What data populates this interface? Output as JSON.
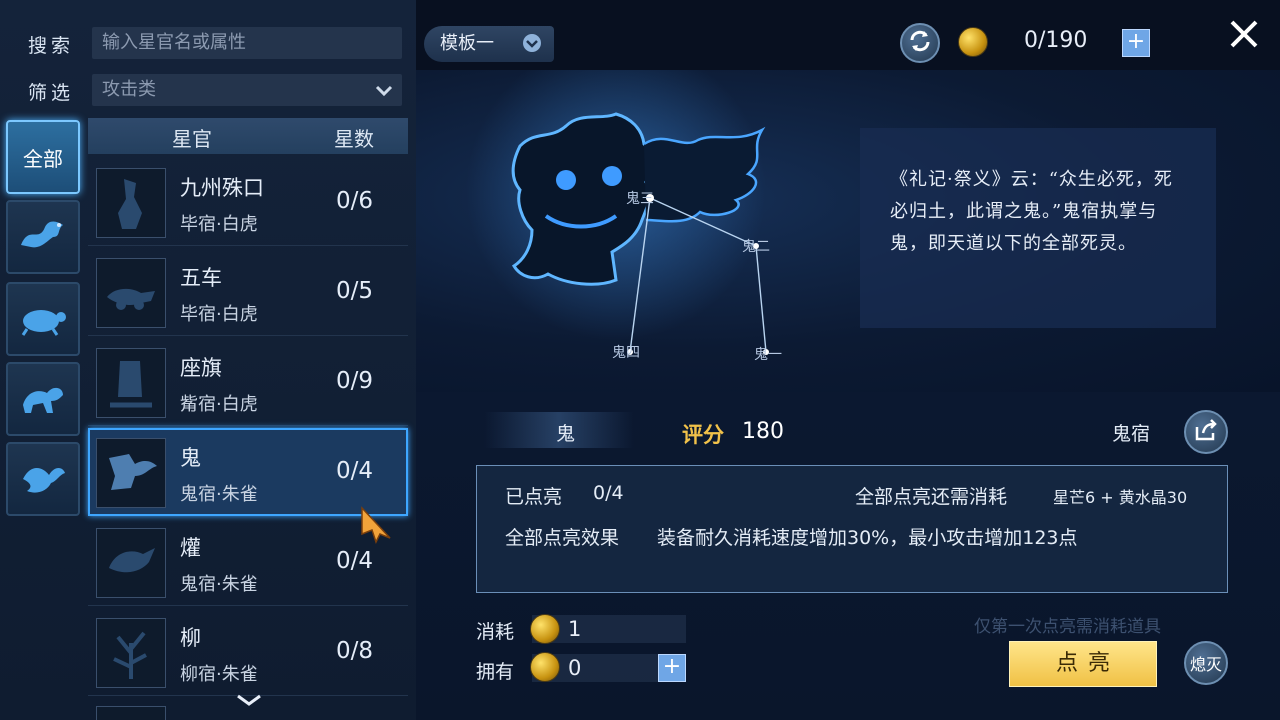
{
  "search": {
    "label": "搜索",
    "placeholder": "输入星官名或属性"
  },
  "filter": {
    "label": "筛选",
    "value": "攻击类"
  },
  "category_tabs": [
    {
      "label": "全部",
      "icon": "all-tab"
    },
    {
      "label": "",
      "icon": "azure-dragon-icon"
    },
    {
      "label": "",
      "icon": "black-tortoise-icon"
    },
    {
      "label": "",
      "icon": "white-tiger-icon"
    },
    {
      "label": "",
      "icon": "vermilion-bird-icon"
    }
  ],
  "list_header": {
    "name": "星官",
    "count": "星数"
  },
  "rows": [
    {
      "name": "九州殊口",
      "sub": "毕宿·白虎",
      "count": "0/6"
    },
    {
      "name": "五车",
      "sub": "毕宿·白虎",
      "count": "0/5"
    },
    {
      "name": "座旗",
      "sub": "觜宿·白虎",
      "count": "0/9"
    },
    {
      "name": "鬼",
      "sub": "鬼宿·朱雀",
      "count": "0/4"
    },
    {
      "name": "爟",
      "sub": "鬼宿·朱雀",
      "count": "0/4"
    },
    {
      "name": "柳",
      "sub": "柳宿·朱雀",
      "count": "0/8"
    }
  ],
  "top_bar": {
    "template": "模板一",
    "currency": "0/190"
  },
  "constellation": {
    "stars": [
      "鬼三",
      "鬼二",
      "鬼四",
      "鬼一"
    ],
    "description": "《礼记·祭义》云：“众生必死，死必归土，此谓之鬼。”鬼宿执掌与鬼，即天道以下的全部死灵。"
  },
  "summary": {
    "name": "鬼",
    "score_label": "评分",
    "score": "180",
    "mansion": "鬼宿"
  },
  "info": {
    "lit_label": "已点亮",
    "lit_value": "0/4",
    "cost_all_label": "全部点亮还需消耗",
    "cost_all_value": "星芒6 + 黄水晶30",
    "effect_label": "全部点亮效果",
    "effect_value": "装备耐久消耗速度增加30%，最小攻击增加123点"
  },
  "cost": {
    "label": "消耗",
    "value": "1"
  },
  "own": {
    "label": "拥有",
    "value": "0"
  },
  "note": "仅第一次点亮需消耗道具",
  "buttons": {
    "light": "点亮",
    "extinguish": "熄灭"
  },
  "colors": {
    "accent": "#3ea6ff",
    "gold": "#f0c145"
  }
}
